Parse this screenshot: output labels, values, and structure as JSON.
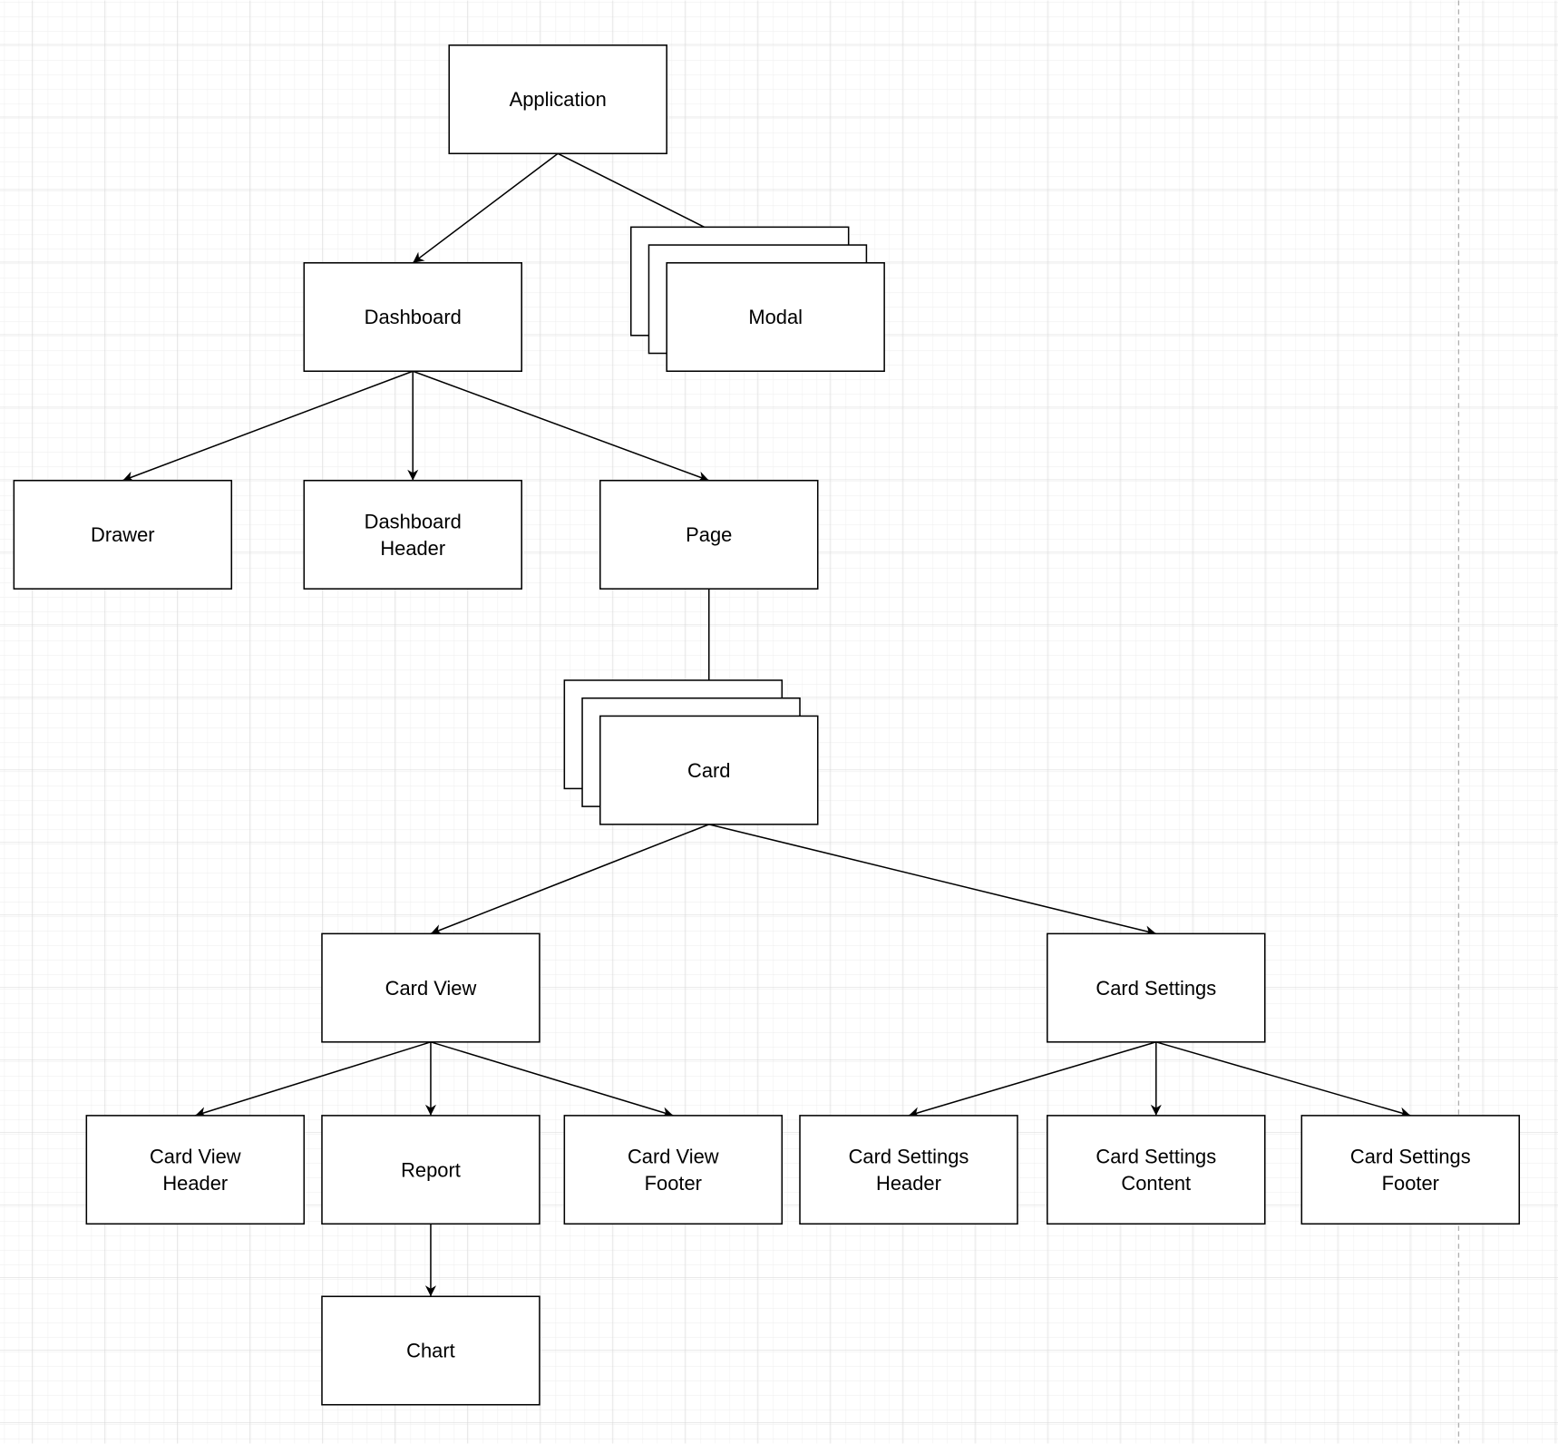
{
  "canvas": {
    "grid": true,
    "page_break_line": "dashed-vertical",
    "grid_color": "#e0e0e0",
    "stroke_color": "#000000"
  },
  "nodes": [
    {
      "id": "application",
      "label": [
        "Application"
      ],
      "stacked": false
    },
    {
      "id": "dashboard",
      "label": [
        "Dashboard"
      ],
      "stacked": false
    },
    {
      "id": "modal",
      "label": [
        "Modal"
      ],
      "stacked": true
    },
    {
      "id": "drawer",
      "label": [
        "Drawer"
      ],
      "stacked": false
    },
    {
      "id": "dashboard-header",
      "label": [
        "Dashboard",
        "Header"
      ],
      "stacked": false
    },
    {
      "id": "page",
      "label": [
        "Page"
      ],
      "stacked": false
    },
    {
      "id": "card",
      "label": [
        "Card"
      ],
      "stacked": true
    },
    {
      "id": "card-view",
      "label": [
        "Card View"
      ],
      "stacked": false
    },
    {
      "id": "card-settings",
      "label": [
        "Card Settings"
      ],
      "stacked": false
    },
    {
      "id": "card-view-header",
      "label": [
        "Card View",
        "Header"
      ],
      "stacked": false
    },
    {
      "id": "report",
      "label": [
        "Report"
      ],
      "stacked": false
    },
    {
      "id": "card-view-footer",
      "label": [
        "Card View",
        "Footer"
      ],
      "stacked": false
    },
    {
      "id": "card-settings-header",
      "label": [
        "Card Settings",
        "Header"
      ],
      "stacked": false
    },
    {
      "id": "card-settings-content",
      "label": [
        "Card Settings",
        "Content"
      ],
      "stacked": false
    },
    {
      "id": "card-settings-footer",
      "label": [
        "Card Settings",
        "Footer"
      ],
      "stacked": false
    },
    {
      "id": "chart",
      "label": [
        "Chart"
      ],
      "stacked": false
    }
  ],
  "edges": [
    [
      "application",
      "dashboard"
    ],
    [
      "application",
      "modal"
    ],
    [
      "dashboard",
      "drawer"
    ],
    [
      "dashboard",
      "dashboard-header"
    ],
    [
      "dashboard",
      "page"
    ],
    [
      "page",
      "card"
    ],
    [
      "card",
      "card-view"
    ],
    [
      "card",
      "card-settings"
    ],
    [
      "card-view",
      "card-view-header"
    ],
    [
      "card-view",
      "report"
    ],
    [
      "card-view",
      "card-view-footer"
    ],
    [
      "card-settings",
      "card-settings-header"
    ],
    [
      "card-settings",
      "card-settings-content"
    ],
    [
      "card-settings",
      "card-settings-footer"
    ],
    [
      "report",
      "chart"
    ]
  ]
}
